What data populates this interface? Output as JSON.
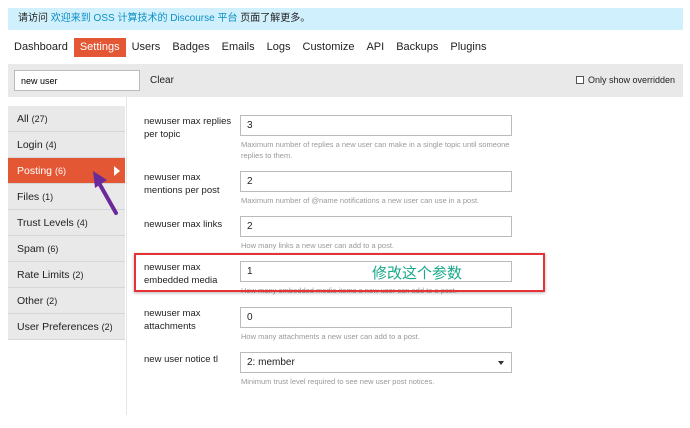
{
  "banner": {
    "prefix": "请访问 ",
    "link": "欢迎来到 OSS 计算技术的 Discourse 平台",
    "suffix": " 页面了解更多。"
  },
  "nav": [
    "Dashboard",
    "Settings",
    "Users",
    "Badges",
    "Emails",
    "Logs",
    "Customize",
    "API",
    "Backups",
    "Plugins"
  ],
  "filter": {
    "value": "new user",
    "clear": "Clear",
    "only_overridden": "Only show overridden"
  },
  "sidebar": [
    {
      "label": "All",
      "count": "(27)"
    },
    {
      "label": "Login",
      "count": "(4)"
    },
    {
      "label": "Posting",
      "count": "(6)"
    },
    {
      "label": "Files",
      "count": "(1)"
    },
    {
      "label": "Trust Levels",
      "count": "(4)"
    },
    {
      "label": "Spam",
      "count": "(6)"
    },
    {
      "label": "Rate Limits",
      "count": "(2)"
    },
    {
      "label": "Other",
      "count": "(2)"
    },
    {
      "label": "User Preferences",
      "count": "(2)"
    }
  ],
  "settings": [
    {
      "label": "newuser max replies per topic",
      "value": "3",
      "desc": "Maximum number of replies a new user can make in a single topic until someone replies to them."
    },
    {
      "label": "newuser max mentions per post",
      "value": "2",
      "desc": "Maximum number of @name notifications a new user can use in a post."
    },
    {
      "label": "newuser max links",
      "value": "2",
      "desc": "How many links a new user can add to a post."
    },
    {
      "label": "newuser max embedded media",
      "value": "1",
      "desc": "How many embedded media items a new user can add to a post."
    },
    {
      "label": "newuser max attachments",
      "value": "0",
      "desc": "How many attachments a new user can add to a post."
    },
    {
      "label": "new user notice tl",
      "value": "2: member",
      "desc": "Minimum trust level required to see new user post notices."
    }
  ],
  "annotation": "修改这个参数",
  "colors": {
    "accent": "#e45735",
    "annotation": "#19a88a",
    "highlight_box": "#e53238",
    "arrow": "#6a2a9a"
  }
}
